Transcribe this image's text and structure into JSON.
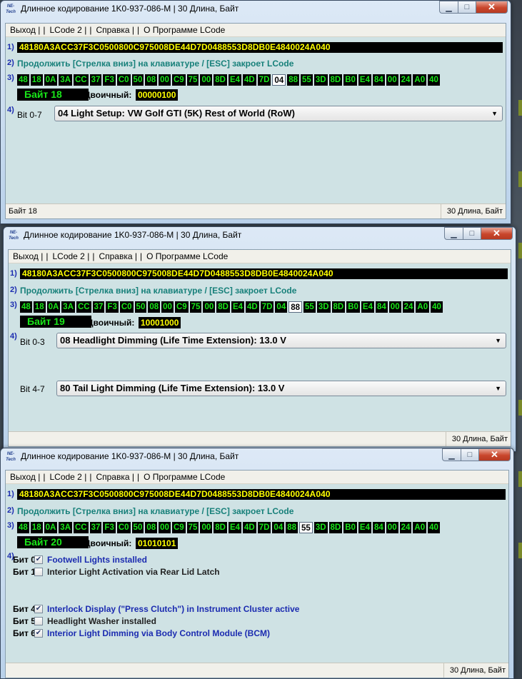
{
  "app_icon_text": "NE-Tech",
  "windows": [
    {
      "title": "Длинное кодирование  1K0-937-086-M | 30 Длина, Байт",
      "menu": [
        "Выход |",
        "LCode 2 |",
        "Справка |",
        "О Программе LCode"
      ],
      "step1": "1)",
      "code": "48180A3ACC37F3C0500800C975008DE44D7D0488553D8DB0E4840024A040",
      "step2": "2)",
      "hint": "Продолжить [Стрелка вниз] на клавиатуре / [ESC] закроет LCode",
      "step3": "3)",
      "byte_label": "Байт 18",
      "binary_label": "Двоичный:",
      "binary_value": "00000100",
      "step4": "4)",
      "bit1_label": "Bit 0-7",
      "bit1_value": "04 Light Setup: VW Golf GTI (5K) Rest of World (RoW)",
      "status_left": "Байт 18",
      "status_right": "30 Длина, Байт"
    },
    {
      "title": "Длинное кодирование  1K0-937-086-M | 30 Длина, Байт",
      "menu": [
        "Выход |",
        "LCode 2 |",
        "Справка |",
        "О Программе LCode"
      ],
      "step1": "1)",
      "code": "48180A3ACC37F3C0500800C975008DE44D7D0488553D8DB0E4840024A040",
      "step2": "2)",
      "hint": "Продолжить [Стрелка вниз] на клавиатуре / [ESC] закроет LCode",
      "step3": "3)",
      "byte_label": "Байт 19",
      "binary_label": "Двоичный:",
      "binary_value": "10001000",
      "step4": "4)",
      "bit1_label": "Bit 0-3",
      "bit1_value": "08 Headlight Dimming (Life Time Extension): 13.0 V",
      "bit2_label": "Bit 4-7",
      "bit2_value": "80 Tail Light Dimming (Life Time Extension): 13.0 V",
      "status_right": "30 Длина, Байт"
    },
    {
      "title": "Длинное кодирование  1K0-937-086-M | 30 Длина, Байт",
      "menu": [
        "Выход |",
        "LCode 2 |",
        "Справка |",
        "О Программе LCode"
      ],
      "step1": "1)",
      "code": "48180A3ACC37F3C0500800C975008DE44D7D0488553D8DB0E4840024A040",
      "step2": "2)",
      "hint": "Продолжить [Стрелка вниз] на клавиатуре / [ESC] закроет LCode",
      "step3": "3)",
      "byte_label": "Байт 20",
      "binary_label": "Двоичный:",
      "binary_value": "01010101",
      "step4": "4)",
      "bits": [
        {
          "label": "Бит 0",
          "checked": true,
          "text": "Footwell Lights installed"
        },
        {
          "label": "Бит 1",
          "checked": false,
          "text": "Interior Light Activation via Rear Lid Latch"
        },
        {
          "label": "Бит 4",
          "checked": true,
          "text": "Interlock Display (\"Press Clutch\") in Instrument Cluster active"
        },
        {
          "label": "Бит 5",
          "checked": false,
          "text": "Headlight Washer installed"
        },
        {
          "label": "Бит 6",
          "checked": true,
          "text": "Interior Light Dimming via Body Control Module (BCM)"
        }
      ],
      "status_right": "30 Длина, Байт"
    }
  ],
  "bytes": [
    "48",
    "18",
    "0A",
    "3A",
    "CC",
    "37",
    "F3",
    "C0",
    "50",
    "08",
    "00",
    "C9",
    "75",
    "00",
    "8D",
    "E4",
    "4D",
    "7D",
    "04",
    "88",
    "55",
    "3D",
    "8D",
    "B0",
    "E4",
    "84",
    "00",
    "24",
    "A0",
    "40"
  ],
  "selected_byte_index": [
    18,
    19,
    20
  ],
  "colors": {
    "code_text": "#ffff00",
    "byte_text": "#19e619",
    "hint_text": "#17807a",
    "bit_on_text": "#1b2bb0",
    "client_bg": "#cfe2e4"
  }
}
